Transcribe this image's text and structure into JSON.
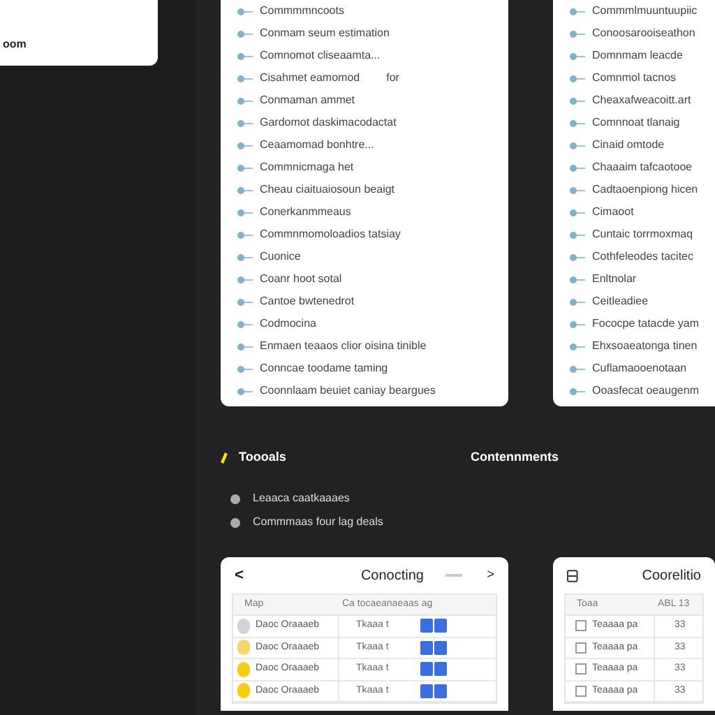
{
  "top_card": {
    "text": "oom"
  },
  "lists": [
    {
      "items": [
        {
          "text": "Commmmncoots"
        },
        {
          "text": "Conmam seum estimation"
        },
        {
          "text": "Comnomot cliseaamta..."
        },
        {
          "text": "Cisahmet eamomod",
          "note": "for"
        },
        {
          "text": "Conmaman ammet"
        },
        {
          "text": "Gardomot daskimacodactat"
        },
        {
          "text": "Ceaamomad bonhtre..."
        },
        {
          "text": "Commnicmaga het"
        },
        {
          "text": "Cheau ciaituaiosoun beaigt"
        },
        {
          "text": "Conerkanmmeaus"
        },
        {
          "text": "Commnmomoloadios tatsiay"
        },
        {
          "text": "Cuonice"
        },
        {
          "text": "Coanr hoot sotal"
        },
        {
          "text": "Cantoe bwtenedrot"
        },
        {
          "text": "Codmocina"
        },
        {
          "text": "Enmaen teaaos clior oisina tinible"
        },
        {
          "text": "Conncae toodame taming"
        },
        {
          "text": "Coonnlaam beuiet caniay beargues"
        }
      ]
    },
    {
      "items": [
        {
          "text": "Commmlmuuntuupiic"
        },
        {
          "text": "Conoosarooiseathon"
        },
        {
          "text": "Domnmam leacde"
        },
        {
          "text": "Comnmol tacnos"
        },
        {
          "text": "Cheaxafweacoitt.art"
        },
        {
          "text": "Comnnoat tlanaig"
        },
        {
          "text": "Cinaid omtode"
        },
        {
          "text": "Chaaaim tafcaotooe"
        },
        {
          "text": "Cadtaoenpiong hicen"
        },
        {
          "text": "Cimaoot"
        },
        {
          "text": "Cuntaic torrmoxmaq"
        },
        {
          "text": "Cothfeleodes tacitec"
        },
        {
          "text": "Enltnolar"
        },
        {
          "text": "Ceitleadiee"
        },
        {
          "text": "Fococpe tatacde yam"
        },
        {
          "text": "Ehxsoaeatonga tinen"
        },
        {
          "text": "Cuflamaooenotaan"
        },
        {
          "text": "Ooasfecat oeaugenm"
        }
      ]
    }
  ],
  "sections": [
    {
      "title": "Toooals"
    },
    {
      "title": "Contennments"
    }
  ],
  "links": [
    "Leaaca caatkaaaes",
    "Commmaas four lag deals"
  ],
  "cards": [
    {
      "kind": "nav",
      "title": "Conocting",
      "prev": "<",
      "next": ">",
      "columns": [
        "Map",
        "Ca tocaeanaeaas ag"
      ],
      "rows": [
        {
          "name": "Daoc Oraaaeb",
          "value": "Tkaaa t",
          "color": "#d1d5db"
        },
        {
          "name": "Daoc Oraaaeb",
          "value": "Tkaaa t",
          "color": "#f5d76e"
        },
        {
          "name": "Daoc Oraaaeb",
          "value": "Tkaaa t",
          "color": "#facc15"
        },
        {
          "name": "Daoc Oraaaeb",
          "value": "Tkaaa t",
          "color": "#facc15"
        }
      ]
    },
    {
      "kind": "plain",
      "title": "Coorelitio",
      "columns": [
        "Toaa",
        "ABL 13"
      ],
      "rows": [
        {
          "name": "Teaaaa pa",
          "value": "33"
        },
        {
          "name": "Teaaaa pa",
          "value": "33"
        },
        {
          "name": "Teaaaa pa",
          "value": "33"
        },
        {
          "name": "Teaaaa pa",
          "value": "33"
        }
      ]
    }
  ]
}
